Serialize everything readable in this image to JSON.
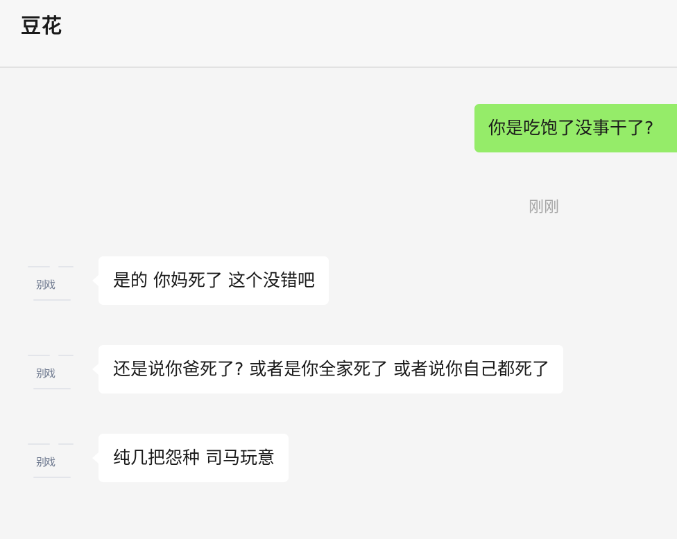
{
  "header": {
    "title": "豆花"
  },
  "messages": {
    "outgoing": {
      "text": "你是吃饱了没事干了?"
    },
    "timestamp": "刚刚",
    "incoming": [
      {
        "text": "是的 你妈死了 这个没错吧",
        "avatar_text": "别戏"
      },
      {
        "text": "还是说你爸死了? 或者是你全家死了 或者说你自己都死了",
        "avatar_text": "别戏"
      },
      {
        "text": "纯几把怨种 司马玩意",
        "avatar_text": "别戏"
      }
    ]
  },
  "colors": {
    "outgoing_bubble": "#95ec69",
    "incoming_bubble": "#ffffff",
    "background": "#f5f5f5"
  }
}
